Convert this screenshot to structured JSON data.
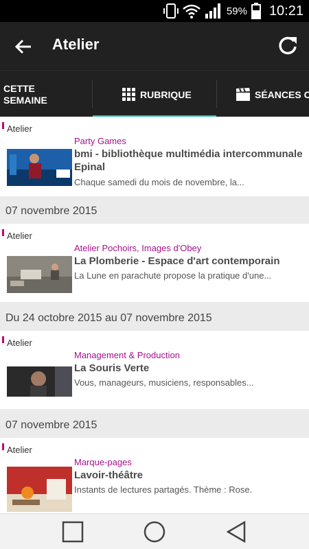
{
  "status": {
    "battery_pct": "59%",
    "time": "10:21"
  },
  "appbar": {
    "title": "Atelier"
  },
  "tabs": {
    "week": "CETTE SEMAINE",
    "rubrique": "RUBRIQUE",
    "seances": "SÉANCES CI"
  },
  "items": [
    {
      "category": "Atelier",
      "tag": "Party Games",
      "name": "bmi - bibliothèque multimédia intercommunale Epinal",
      "desc": "Chaque samedi du mois de novembre, la..."
    },
    {
      "category": "Atelier",
      "tag": "Atelier Pochoirs, Images d'Obey",
      "name": "La Plomberie - Espace d'art contemporain",
      "desc": "La Lune en parachute propose la pratique d'une..."
    },
    {
      "category": "Atelier",
      "tag": "Management & Production",
      "name": "La Souris Verte",
      "desc": "Vous, manageurs, musiciens, responsables..."
    },
    {
      "category": "Atelier",
      "tag": "Marque-pages",
      "name": "Lavoir-théâtre",
      "desc": "Instants de lectures partagés. Thème : Rose."
    }
  ],
  "dates": [
    "07 novembre 2015",
    "Du 24 octobre 2015 au 07 novembre 2015",
    "07 novembre 2015"
  ],
  "colors": {
    "accent": "#2db8a9",
    "tag": "#a5118d",
    "bar": "#212121"
  }
}
